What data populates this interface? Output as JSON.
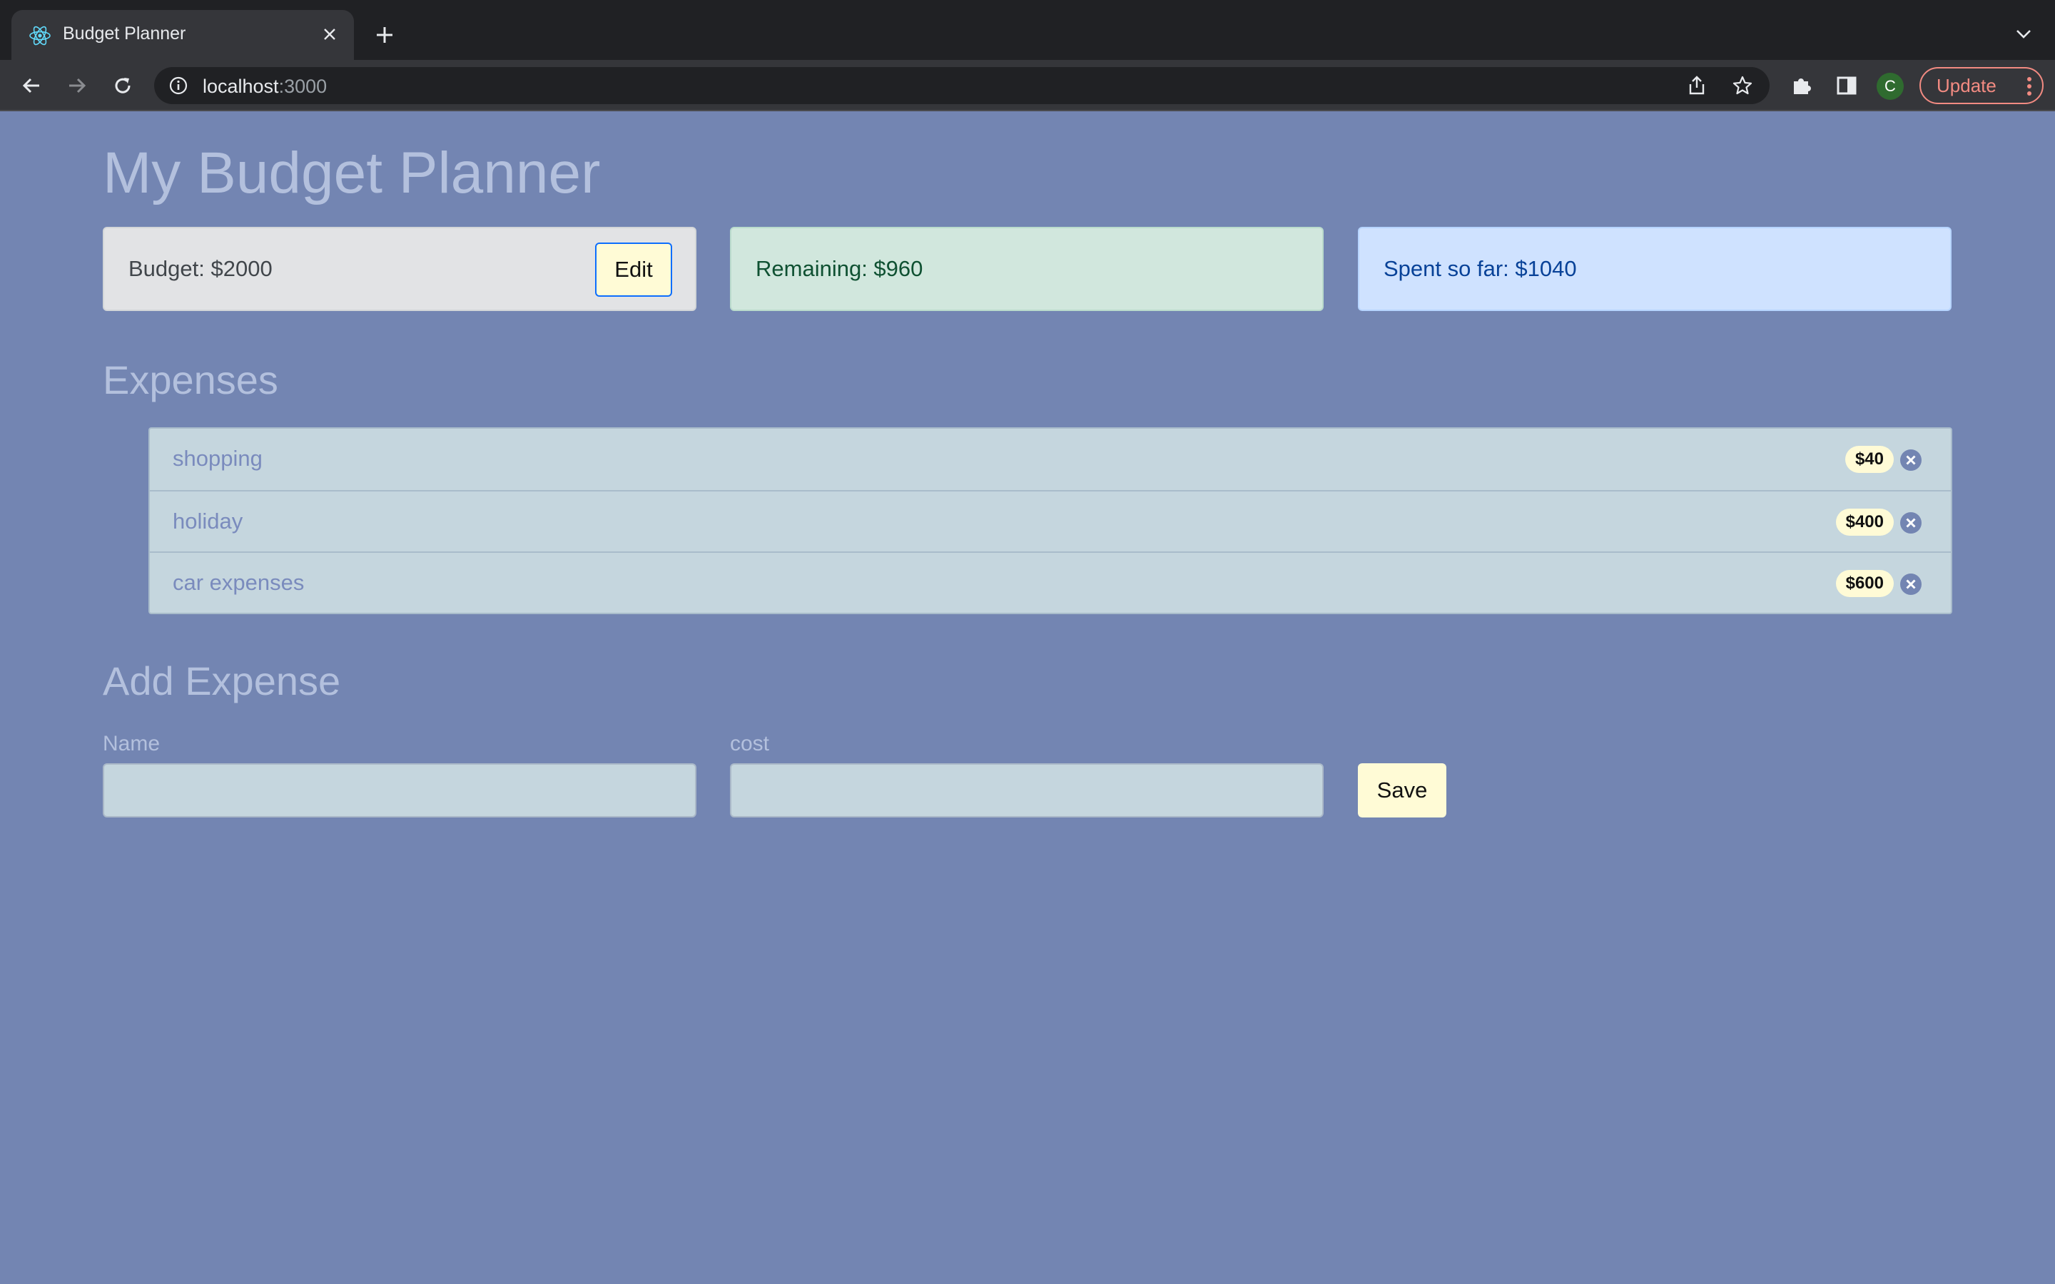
{
  "browser": {
    "tab_title": "Budget Planner",
    "url_host": "localhost",
    "url_port": ":3000",
    "profile_initial": "C",
    "update_label": "Update"
  },
  "app": {
    "title": "My Budget Planner",
    "budget_text": "Budget: $2000",
    "edit_label": "Edit",
    "remaining_text": "Remaining: $960",
    "spent_text": "Spent so far: $1040",
    "expenses_heading": "Expenses",
    "expenses": [
      {
        "name": "shopping",
        "cost": "$40"
      },
      {
        "name": "holiday",
        "cost": "$400"
      },
      {
        "name": "car expenses",
        "cost": "$600"
      }
    ],
    "add_heading": "Add Expense",
    "name_label": "Name",
    "name_value": "",
    "cost_label": "cost",
    "cost_value": "",
    "save_label": "Save"
  },
  "colors": {
    "page_background": "#7385b2",
    "secondary_alert": "#e2e3e5",
    "success_alert": "#d1e7dd",
    "primary_alert": "#cfe2ff",
    "list_background": "#c5d6de",
    "badge_background": "#fffbd6",
    "delete_icon": "#7385b2"
  }
}
